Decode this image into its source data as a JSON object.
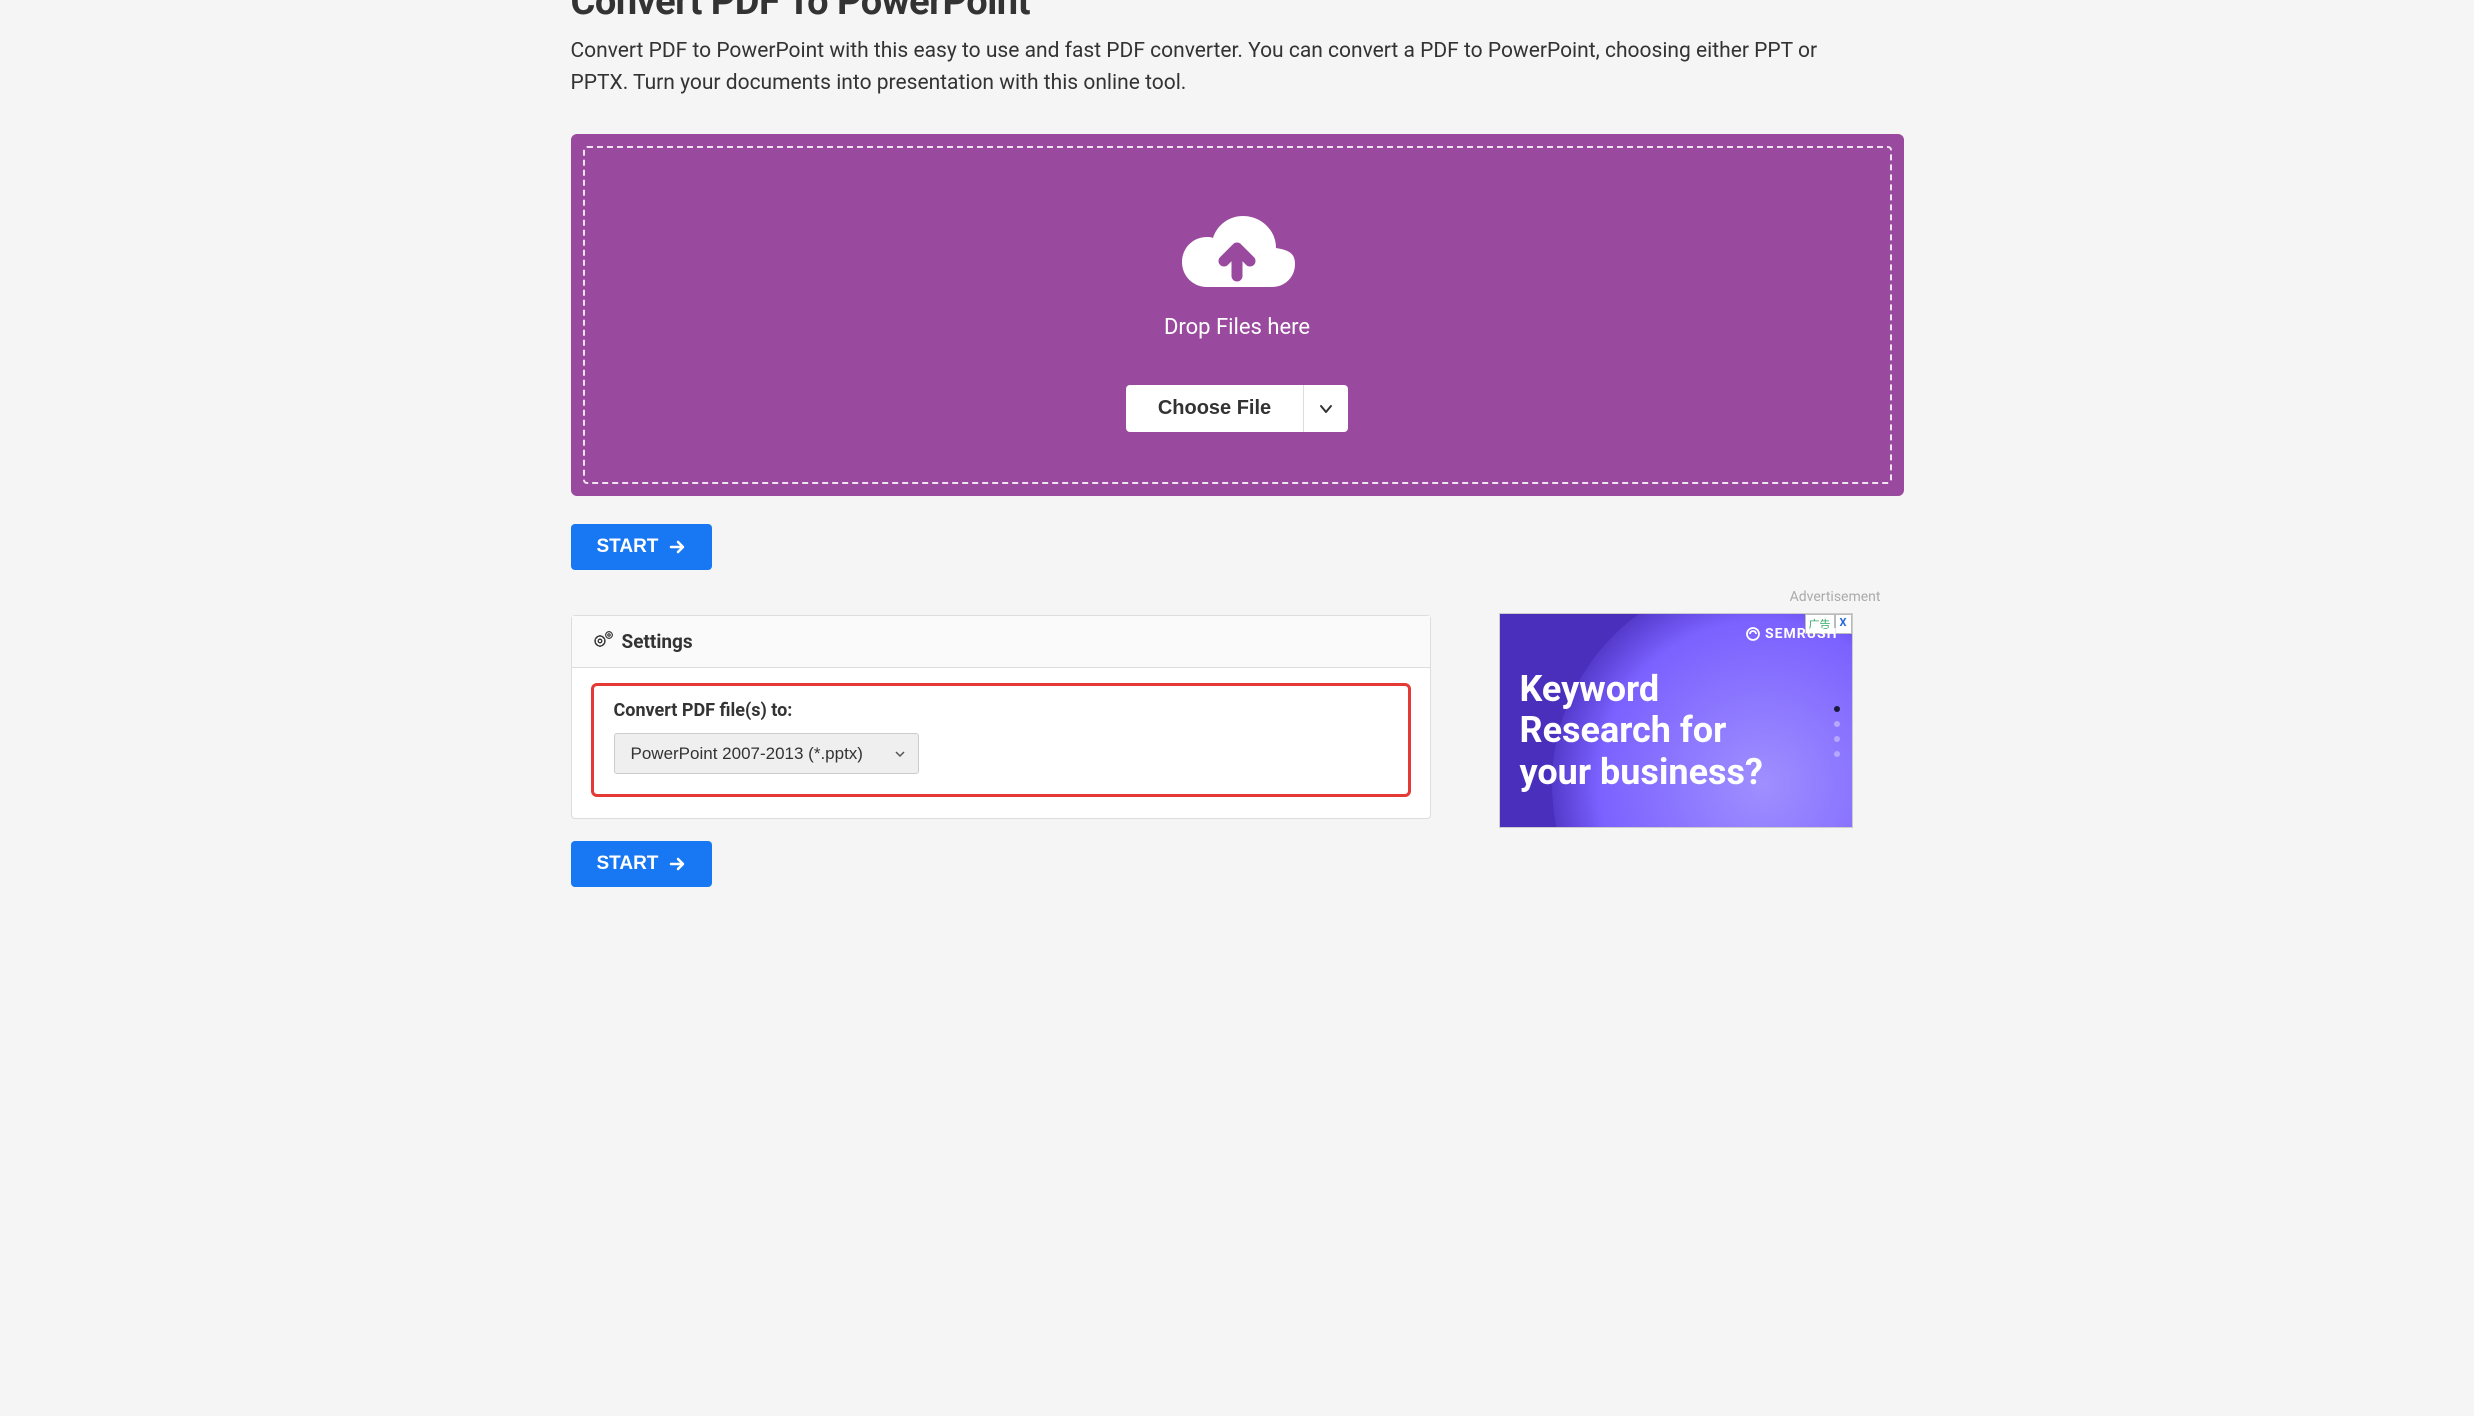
{
  "page": {
    "title": "Convert PDF To PowerPoint",
    "subtitle": "Convert PDF to PowerPoint with this easy to use and fast PDF converter. You can convert a PDF to PowerPoint, choosing either PPT or PPTX. Turn your documents into presentation with this online tool."
  },
  "dropzone": {
    "drop_text": "Drop Files here",
    "choose_file_label": "Choose File"
  },
  "buttons": {
    "start_label": "START"
  },
  "settings": {
    "header_label": "Settings",
    "convert_label": "Convert PDF file(s) to:",
    "format_selected": "PowerPoint 2007-2013 (*.pptx)"
  },
  "ad": {
    "label": "Advertisement",
    "badge_text": "广告",
    "close_text": "X",
    "brand": "SEMRUSH",
    "headline_line1": "Keyword",
    "headline_line2": "Research for",
    "headline_line3": "your business?"
  },
  "colors": {
    "dropzone_bg": "#9A4A9E",
    "primary_button": "#1877F2",
    "highlight_border": "#E53935",
    "ad_bg": "#4A2FBD"
  }
}
